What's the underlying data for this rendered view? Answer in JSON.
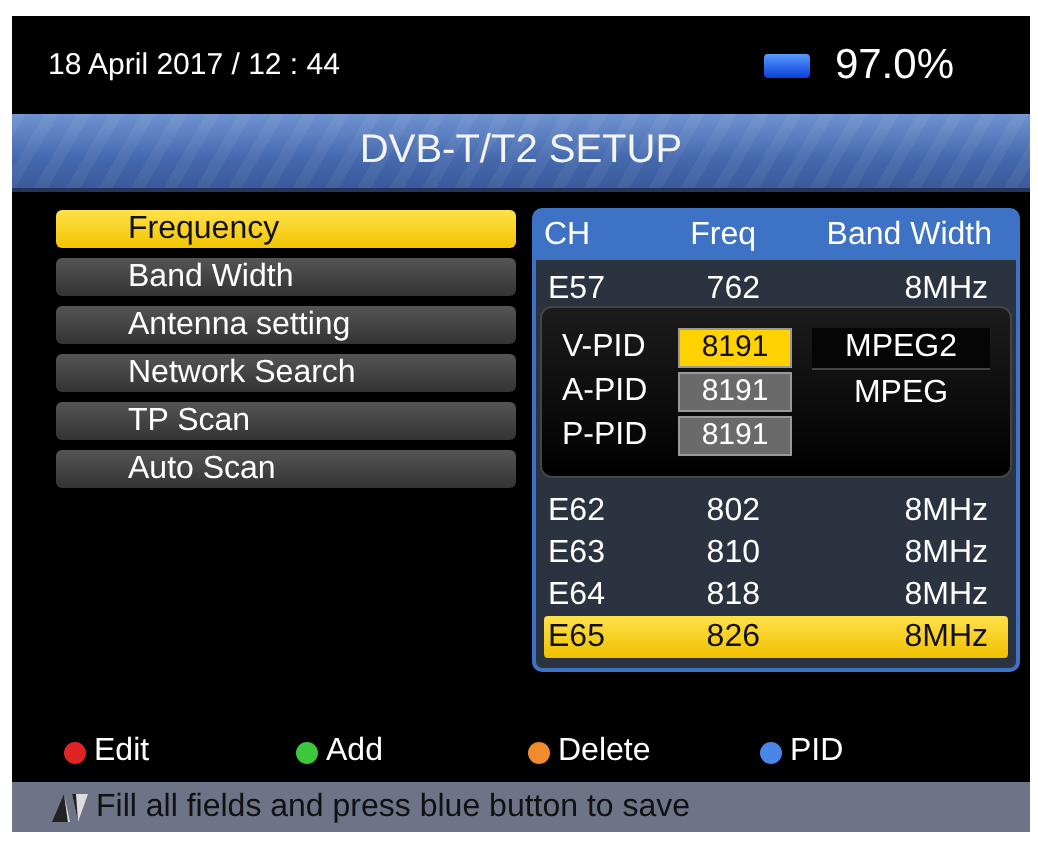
{
  "header": {
    "datetime": "18 April 2017 / 12 : 44",
    "battery": "97.0%"
  },
  "title_bar": {
    "title": "DVB-T/T2 SETUP"
  },
  "menu": [
    {
      "label": "Frequency",
      "selected": true
    },
    {
      "label": "Band Width",
      "selected": false
    },
    {
      "label": "Antenna setting",
      "selected": false
    },
    {
      "label": "Network Search",
      "selected": false
    },
    {
      "label": "TP Scan",
      "selected": false
    },
    {
      "label": "Auto Scan",
      "selected": false
    }
  ],
  "table": {
    "columns": [
      "CH",
      "Freq",
      "Band Width"
    ],
    "rows_above": [
      {
        "cells": [
          "E57",
          "762",
          "8MHz"
        ],
        "selected": false
      }
    ],
    "rows": [
      {
        "cells": [
          "E62",
          "802",
          "8MHz"
        ],
        "selected": false
      },
      {
        "cells": [
          "E63",
          "810",
          "8MHz"
        ],
        "selected": false
      },
      {
        "cells": [
          "E64",
          "818",
          "8MHz"
        ],
        "selected": false
      },
      {
        "cells": [
          "E65",
          "826",
          "8MHz"
        ],
        "selected": true
      }
    ]
  },
  "pid_dialog": {
    "fields": [
      {
        "label": "V-PID",
        "value": "8191",
        "selected": true
      },
      {
        "label": "A-PID",
        "value": "8191",
        "selected": false
      },
      {
        "label": "P-PID",
        "value": "8191",
        "selected": false
      }
    ],
    "codecs": [
      {
        "label": "MPEG2",
        "selected": true
      },
      {
        "label": "MPEG",
        "selected": false
      }
    ]
  },
  "legend": [
    {
      "label": "Edit",
      "color": "#e02424"
    },
    {
      "label": "Add",
      "color": "#3cc83c"
    },
    {
      "label": "Delete",
      "color": "#f08c2c"
    },
    {
      "label": "PID",
      "color": "#4a86e6"
    }
  ],
  "status_bar": {
    "hint": "Fill all fields and press blue button to save"
  }
}
